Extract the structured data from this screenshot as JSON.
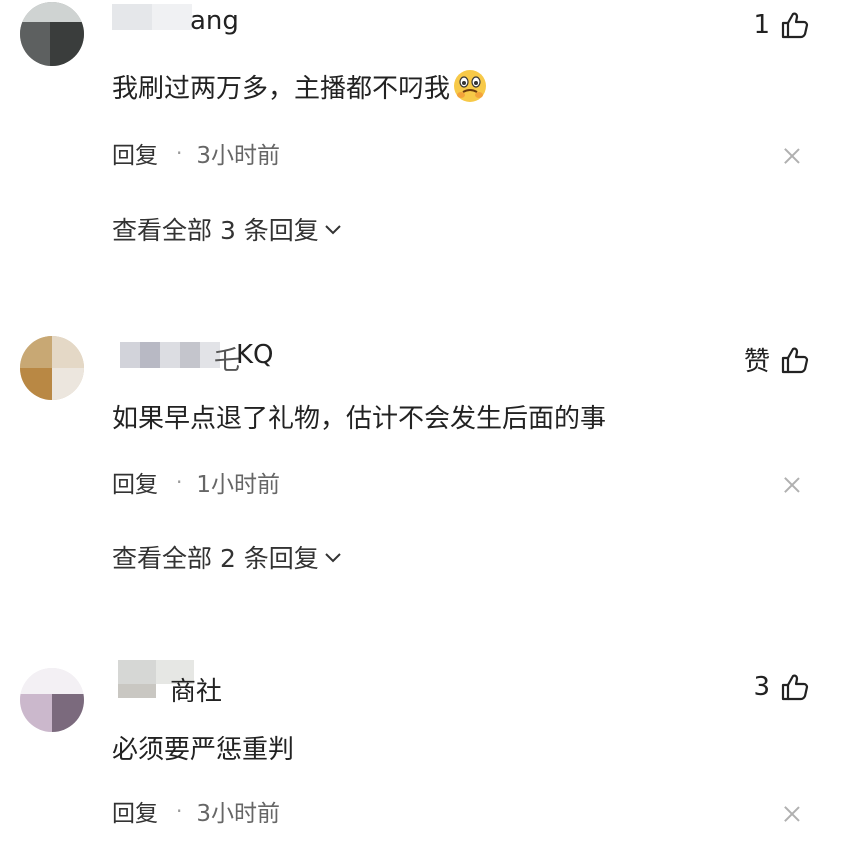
{
  "comments": [
    {
      "username_visible": "ang",
      "likes": "1",
      "text": "我刷过两万多，主播都不叼我",
      "emoji": "grimacing-face",
      "reply_label": "回复",
      "separator": "·",
      "time": "3小时前",
      "view_all": "查看全部 3 条回复"
    },
    {
      "username_visible": "KQ",
      "likes": "赞",
      "text": "如果早点退了礼物，估计不会发生后面的事",
      "reply_label": "回复",
      "separator": "·",
      "time": "1小时前",
      "view_all": "查看全部 2 条回复"
    },
    {
      "username_visible": "商社",
      "likes": "3",
      "text": "必须要严惩重判",
      "reply_label": "回复",
      "separator": "·",
      "time": "3小时前"
    }
  ],
  "icons": {
    "like": "thumbs-up-icon",
    "close": "close-icon",
    "expand": "chevron-down-icon"
  }
}
